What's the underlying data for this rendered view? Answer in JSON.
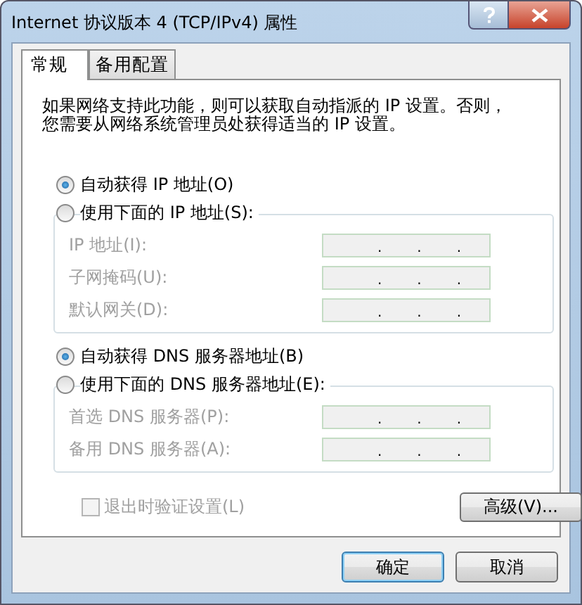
{
  "window": {
    "title": "Internet 协议版本 4 (TCP/IPv4) 属性"
  },
  "tabs": [
    {
      "label": "常规",
      "selected": true
    },
    {
      "label": "备用配置",
      "selected": false
    }
  ],
  "description": "如果网络支持此功能，则可以获取自动指派的 IP 设置。否则，您需要从网络系统管理员处获得适当的 IP 设置。",
  "sections": [
    {
      "options": [
        {
          "label": "自动获得 IP 地址(O)",
          "selected": true
        },
        {
          "label": "使用下面的 IP 地址(S):",
          "selected": false
        }
      ],
      "fields": [
        {
          "label": "IP 地址(I):",
          "disabled": true,
          "separators": [
            ".",
            ".",
            "."
          ]
        },
        {
          "label": "子网掩码(U):",
          "disabled": true,
          "separators": [
            ".",
            ".",
            "."
          ]
        },
        {
          "label": "默认网关(D):",
          "disabled": true,
          "separators": [
            ".",
            ".",
            "."
          ]
        }
      ]
    },
    {
      "options": [
        {
          "label": "自动获得 DNS 服务器地址(B)",
          "selected": true
        },
        {
          "label": "使用下面的 DNS 服务器地址(E):",
          "selected": false
        }
      ],
      "fields": [
        {
          "label": "首选 DNS 服务器(P):",
          "disabled": true,
          "separators": [
            ".",
            ".",
            "."
          ]
        },
        {
          "label": "备用 DNS 服务器(A):",
          "disabled": true,
          "separators": [
            ".",
            ".",
            "."
          ]
        }
      ]
    }
  ],
  "validate_checkbox": {
    "label": "退出时验证设置(L)",
    "checked": false,
    "disabled": true
  },
  "advanced_button": {
    "label": "高级(V)..."
  },
  "buttons": [
    {
      "label": "确定",
      "default": true
    },
    {
      "label": "取消",
      "default": false
    }
  ]
}
